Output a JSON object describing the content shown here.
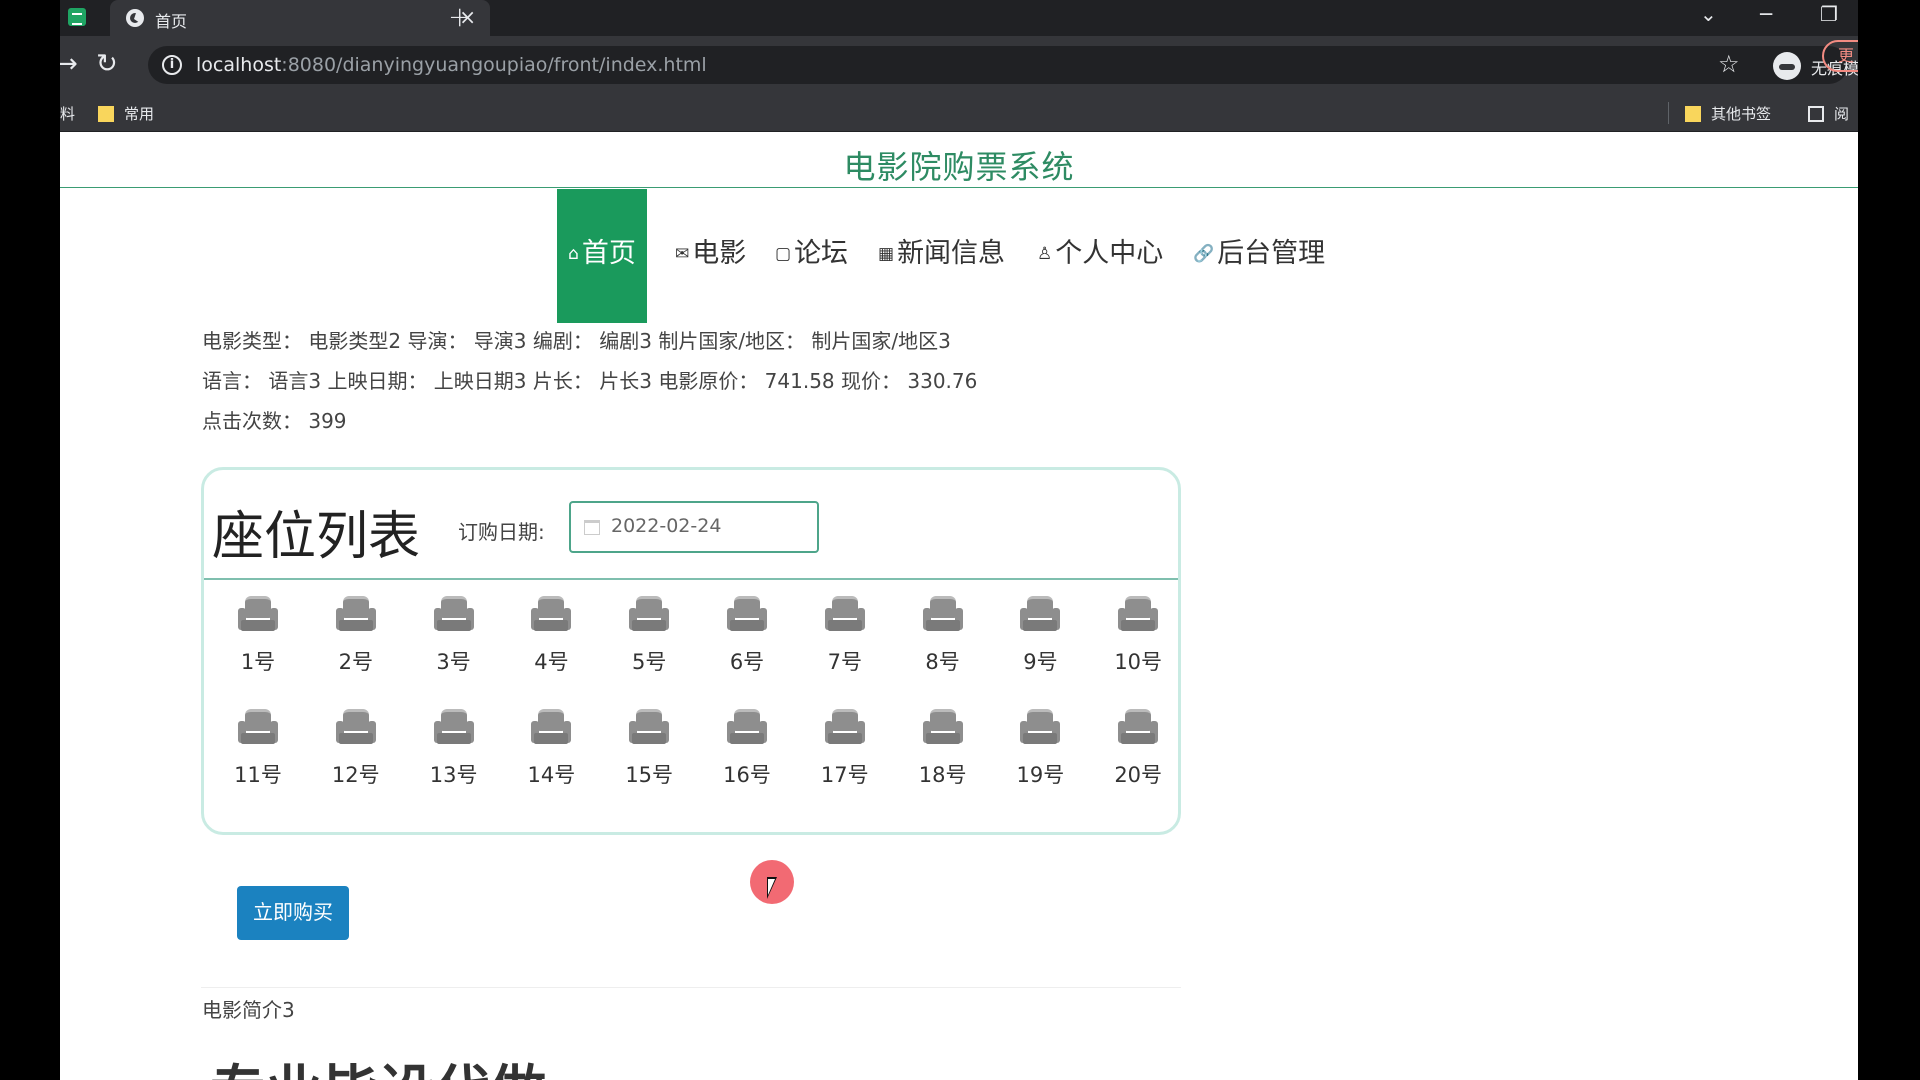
{
  "browser": {
    "tab_title": "首页",
    "tab_close": "×",
    "new_tab": "+",
    "url_host": "localhost",
    "url_rest": ":8080/dianyingyuangoupiao/front/index.html",
    "incognito_label": "无痕模式",
    "update_label": "更",
    "bookmarks": {
      "left_item": "料",
      "common": "常用",
      "other": "其他书签",
      "reader": "阅"
    }
  },
  "site": {
    "title": "电影院购票系统"
  },
  "nav": {
    "items": [
      {
        "glyph": "⌂",
        "label": "首页"
      },
      {
        "glyph": "✉",
        "label": "电影"
      },
      {
        "glyph": "▢",
        "label": "论坛"
      },
      {
        "glyph": "▦",
        "label": "新闻信息"
      },
      {
        "glyph": "♙",
        "label": "个人中心"
      },
      {
        "glyph": "🔗",
        "label": "后台管理"
      }
    ]
  },
  "movie": {
    "line1": "电影类型：  电影类型2    导演：  导演3    编剧：  编剧3    制片国家/地区：  制片国家/地区3",
    "line2": "语言：  语言3    上映日期：  上映日期3    片长：  片长3    电影原价：  741.58    现价：  330.76",
    "line3": "点击次数：  399"
  },
  "seats": {
    "title": "座位列表",
    "date_label": "订购日期:",
    "date_value": "2022-02-24",
    "row1": [
      "1号",
      "2号",
      "3号",
      "4号",
      "5号",
      "6号",
      "7号",
      "8号",
      "9号",
      "10号"
    ],
    "row2": [
      "11号",
      "12号",
      "13号",
      "14号",
      "15号",
      "16号",
      "17号",
      "18号",
      "19号",
      "20号"
    ]
  },
  "buy_button": "立即购买",
  "intro": "电影简介3",
  "big_text": "专业毕设代做",
  "colors": {
    "brand_green": "#1a9a5c",
    "title_green": "#2e8b63",
    "buy_blue": "#1b82c0"
  }
}
